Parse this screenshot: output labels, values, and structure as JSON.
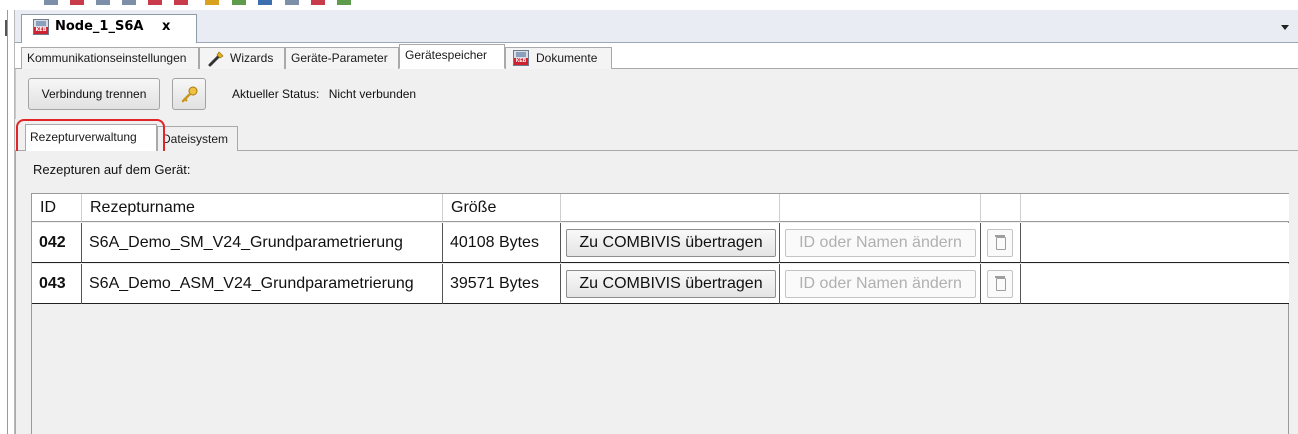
{
  "document_tab": {
    "title": "Node_1_S6A",
    "close_symbol": "x"
  },
  "sub_tabs": [
    {
      "label": "Kommunikationseinstellungen"
    },
    {
      "label": "Wizards"
    },
    {
      "label": "Geräte-Parameter"
    },
    {
      "label": "Gerätespeicher"
    },
    {
      "label": "Dokumente"
    }
  ],
  "toolbar": {
    "disconnect_label": "Verbindung trennen",
    "status_caption": "Aktueller Status:",
    "status_value": "Nicht verbunden"
  },
  "inner_tabs": [
    {
      "label": "Rezepturverwaltung"
    },
    {
      "label": "Dateisystem"
    }
  ],
  "panel": {
    "heading": "Rezepturen auf dem Gerät:"
  },
  "table": {
    "columns": [
      "ID",
      "Rezepturname",
      "Größe"
    ],
    "rows": [
      {
        "id": "042",
        "name": "S6A_Demo_SM_V24_Grundparametrierung",
        "size": "40108 Bytes",
        "transfer": "Zu COMBIVIS übertragen",
        "rename": "ID oder Namen ändern"
      },
      {
        "id": "043",
        "name": "S6A_Demo_ASM_V24_Grundparametrierung",
        "size": "39571 Bytes",
        "transfer": "Zu COMBIVIS übertragen",
        "rename": "ID oder Namen ändern"
      }
    ]
  },
  "colors": {
    "highlight": "#e02626",
    "keb_red": "#cf2231",
    "key_gold": "#d9a21e"
  },
  "icons": [
    "keb-document-icon",
    "wand-icon",
    "key-icon",
    "trash-icon",
    "dropdown-arrow-icon"
  ]
}
